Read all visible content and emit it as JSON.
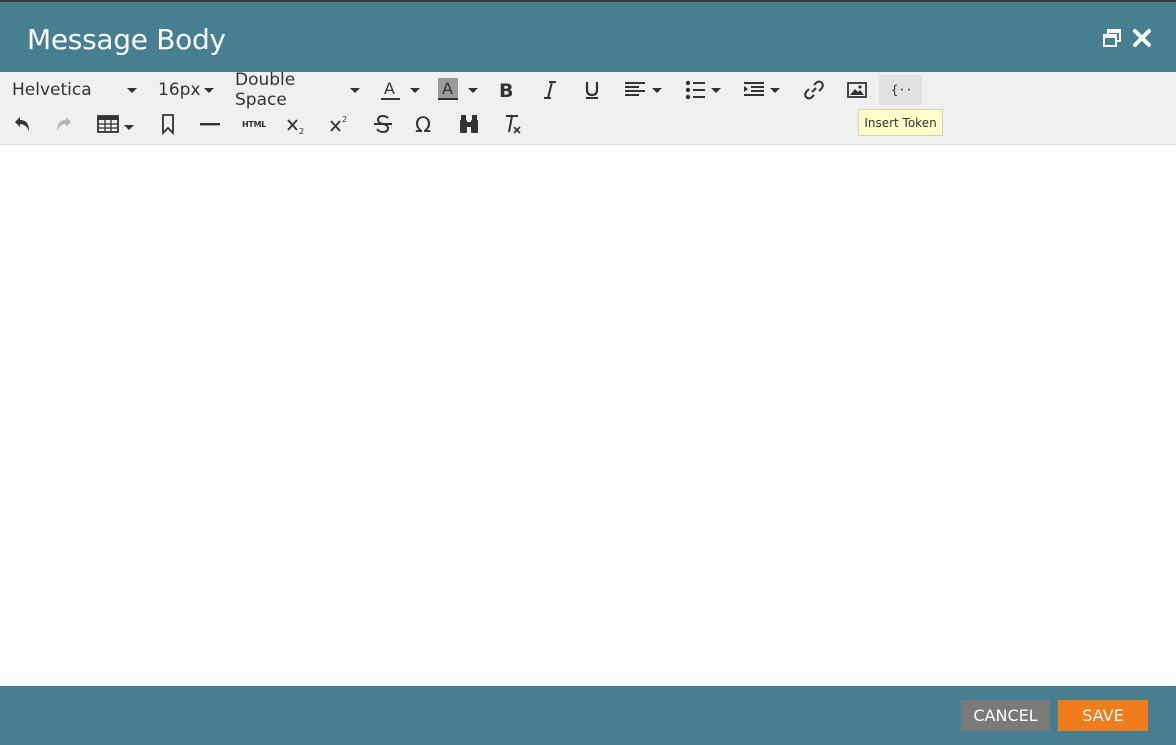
{
  "dialog": {
    "title": "Message Body"
  },
  "toolbar": {
    "font_family": "Helvetica",
    "font_size": "16px",
    "line_spacing": "Double Space",
    "html_label": "HTML",
    "tooltip": "Insert Token"
  },
  "footer": {
    "cancel_label": "CANCEL",
    "save_label": "SAVE"
  },
  "colors": {
    "header_bg": "#467f92",
    "toolbar_bg": "#f0f0f0",
    "save_bg": "#f07c1c",
    "cancel_bg": "#7a7a7a"
  }
}
